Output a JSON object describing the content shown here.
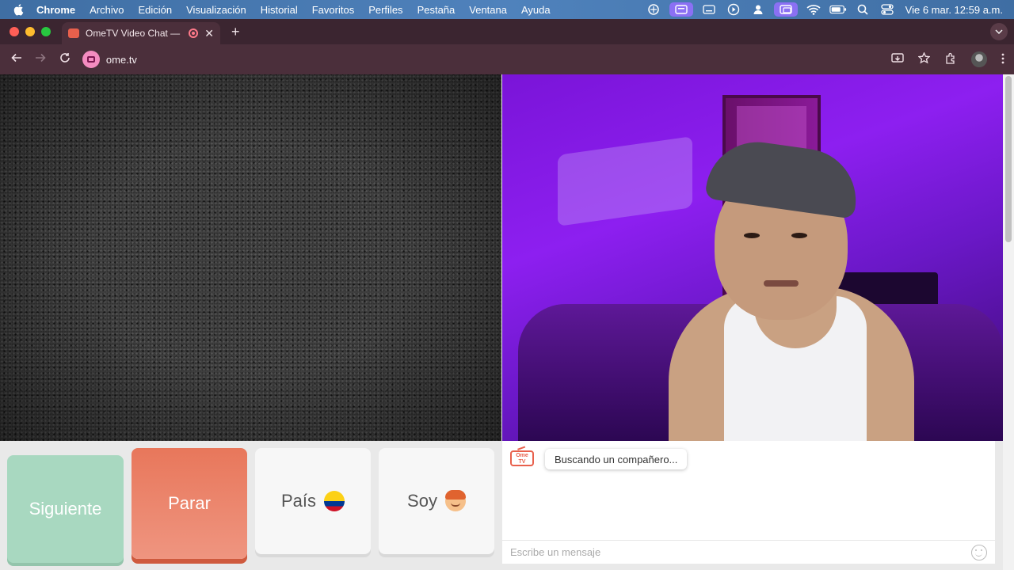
{
  "menubar": {
    "app": "Chrome",
    "items": [
      "Archivo",
      "Edición",
      "Visualización",
      "Historial",
      "Favoritos",
      "Perfiles",
      "Pestaña",
      "Ventana",
      "Ayuda"
    ],
    "clock": "Vie 6 mar.  12:59 a.m."
  },
  "tab": {
    "title": "OmeTV Video Chat — Om",
    "new_tab": "+",
    "close": "✕"
  },
  "toolbar": {
    "url": "ome.tv"
  },
  "controls": {
    "next_label": "Siguiente",
    "stop_label": "Parar",
    "country_label": "País",
    "me_label": "Soy"
  },
  "chat": {
    "logo_text": "Ome TV",
    "status_message": "Buscando un compañero...",
    "input_placeholder": "Escribe un mensaje"
  },
  "colors": {
    "next_button": "#a8d8c0",
    "stop_button": "#e8775b",
    "accent": "#e8604c"
  }
}
